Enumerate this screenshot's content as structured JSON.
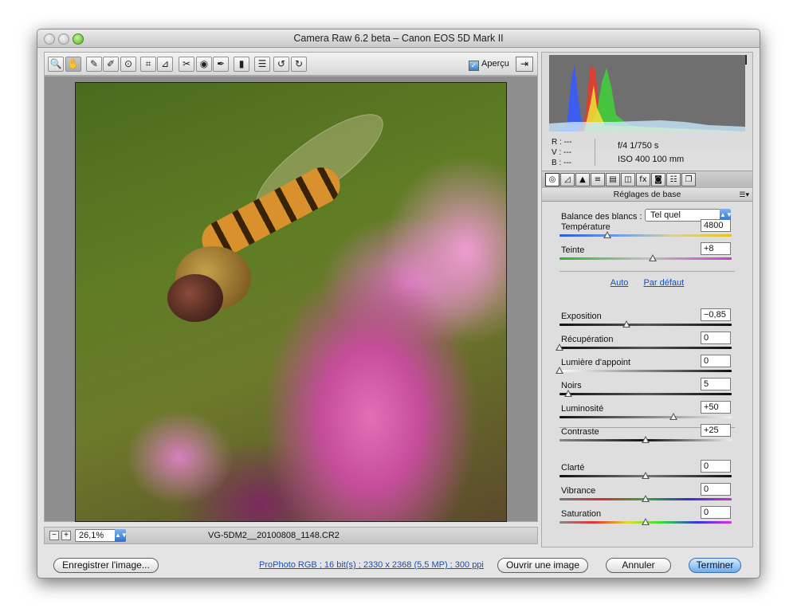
{
  "window": {
    "title": "Camera Raw 6.2 beta  –  Canon EOS 5D Mark II"
  },
  "toolbar": {
    "tools": [
      {
        "name": "zoom-tool-icon",
        "glyph": "🔍"
      },
      {
        "name": "hand-tool-icon",
        "glyph": "✋"
      },
      {
        "name": "white-balance-tool-icon",
        "glyph": "✎"
      },
      {
        "name": "color-sampler-tool-icon",
        "glyph": "✐"
      },
      {
        "name": "targeted-adjustment-tool-icon",
        "glyph": "⊙"
      },
      {
        "name": "crop-tool-icon",
        "glyph": "⌗"
      },
      {
        "name": "straighten-tool-icon",
        "glyph": "⊿"
      },
      {
        "name": "spot-removal-tool-icon",
        "glyph": "✂"
      },
      {
        "name": "red-eye-tool-icon",
        "glyph": "◉"
      },
      {
        "name": "adjustment-brush-icon",
        "glyph": "✒"
      },
      {
        "name": "graduated-filter-icon",
        "glyph": "▮"
      },
      {
        "name": "preferences-icon",
        "glyph": "☰"
      },
      {
        "name": "rotate-left-icon",
        "glyph": "↺"
      },
      {
        "name": "rotate-right-icon",
        "glyph": "↻"
      }
    ],
    "preview_label": "Aperçu"
  },
  "bottombar": {
    "zoom_out": "−",
    "zoom_in": "+",
    "zoom_value": "26,1%",
    "filename": "VG-5DM2__20100808_1148.CR2"
  },
  "info": {
    "r": "R :  ---",
    "v": "V :  ---",
    "b": "B :  ---",
    "aperture_shutter": "f/4    1/750 s",
    "iso_focal": "ISO 400    100 mm"
  },
  "panel_tabs": [
    {
      "name": "tab-basic-icon",
      "glyph": "◎"
    },
    {
      "name": "tab-tone-curve-icon",
      "glyph": "◿"
    },
    {
      "name": "tab-detail-icon",
      "glyph": "▲"
    },
    {
      "name": "tab-hsl-icon",
      "glyph": "≡"
    },
    {
      "name": "tab-split-toning-icon",
      "glyph": "▤"
    },
    {
      "name": "tab-lens-icon",
      "glyph": "◫"
    },
    {
      "name": "tab-effects-icon",
      "glyph": "fx"
    },
    {
      "name": "tab-camera-calibration-icon",
      "glyph": "◙"
    },
    {
      "name": "tab-presets-icon",
      "glyph": "☷"
    },
    {
      "name": "tab-snapshots-icon",
      "glyph": "❐"
    }
  ],
  "panel": {
    "title": "Réglages de base",
    "wb_label": "Balance des blancs :",
    "wb_value": "Tel quel",
    "auto_link": "Auto",
    "default_link": "Par défaut"
  },
  "sliders": [
    {
      "key": "temperature",
      "label": "Température",
      "value": "4800",
      "pos": 0.28
    },
    {
      "key": "tint",
      "label": "Teinte",
      "value": "+8",
      "pos": 0.54
    },
    {
      "key": "exposure",
      "label": "Exposition",
      "value": "−0,85",
      "pos": 0.39
    },
    {
      "key": "recovery",
      "label": "Récupération",
      "value": "0",
      "pos": 0.0
    },
    {
      "key": "fill-light",
      "label": "Lumière d'appoint",
      "value": "0",
      "pos": 0.0
    },
    {
      "key": "blacks",
      "label": "Noirs",
      "value": "5",
      "pos": 0.05
    },
    {
      "key": "brightness",
      "label": "Luminosité",
      "value": "+50",
      "pos": 0.66
    },
    {
      "key": "contrast",
      "label": "Contraste",
      "value": "+25",
      "pos": 0.5
    },
    {
      "key": "clarity",
      "label": "Clarté",
      "value": "0",
      "pos": 0.5
    },
    {
      "key": "vibrance",
      "label": "Vibrance",
      "value": "0",
      "pos": 0.5
    },
    {
      "key": "saturation",
      "label": "Saturation",
      "value": "0",
      "pos": 0.5
    }
  ],
  "footer": {
    "save_label": "Enregistrer l'image...",
    "workflow_link": "ProPhoto RGB ; 16 bit(s) ; 2330 x 2368 (5,5 MP) ; 300 ppi",
    "open_label": "Ouvrir une image",
    "cancel_label": "Annuler",
    "done_label": "Terminer"
  },
  "colors": {
    "accent": "#3b7fd0",
    "link": "#1a4fb3"
  }
}
